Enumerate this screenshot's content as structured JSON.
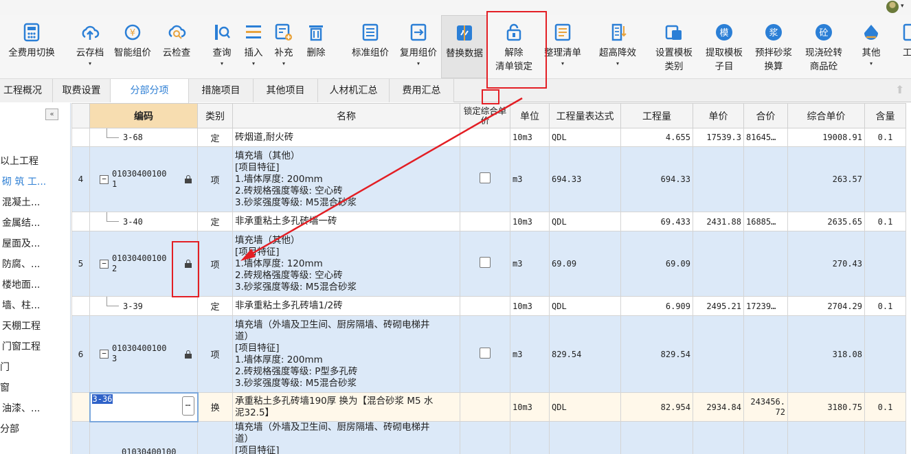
{
  "toolbar": {
    "buttons": [
      {
        "label": "全费用切换",
        "icon": "calculator-icon",
        "color": "#2b7fd6"
      },
      {
        "label": "云存档",
        "icon": "cloud-upload-icon",
        "color": "#2b7fd6"
      },
      {
        "label": "智能组价",
        "icon": "smart-price-icon",
        "color": "#2b7fd6"
      },
      {
        "label": "云检查",
        "icon": "cloud-search-icon",
        "color": "#2b7fd6"
      },
      {
        "label": "查询",
        "icon": "query-icon",
        "color": "#2b7fd6"
      },
      {
        "label": "插入",
        "icon": "insert-icon",
        "color": "#2b7fd6"
      },
      {
        "label": "补充",
        "icon": "supplement-icon",
        "color": "#2b7fd6"
      },
      {
        "label": "删除",
        "icon": "trash-icon",
        "color": "#2b7fd6"
      },
      {
        "label": "标准组价",
        "icon": "standard-price-icon",
        "color": "#2b7fd6"
      },
      {
        "label": "复用组价",
        "icon": "reuse-price-icon",
        "color": "#2b7fd6"
      },
      {
        "label": "替换数据",
        "icon": "replace-data-icon",
        "color": "#2b7fd6"
      },
      {
        "label": "解除",
        "label2": "清单锁定",
        "icon": "unlock-icon",
        "color": "#2b7fd6"
      },
      {
        "label": "整理清单",
        "icon": "organize-list-icon",
        "color": "#2b7fd6"
      },
      {
        "label": "超高降效",
        "icon": "high-rise-icon",
        "color": "#2b7fd6"
      },
      {
        "label": "设置模板",
        "label2": "类别",
        "icon": "template-category-icon",
        "color": "#2b7fd6"
      },
      {
        "label": "提取模板",
        "label2": "子目",
        "icon": "extract-template-icon",
        "glyph": "模",
        "color": "#2b7fd6"
      },
      {
        "label": "预拌砂浆",
        "label2": "换算",
        "icon": "mortar-icon",
        "glyph": "浆",
        "color": "#2b7fd6"
      },
      {
        "label": "现浇砼转",
        "label2": "商品砼",
        "icon": "concrete-icon",
        "glyph": "砼",
        "color": "#2b7fd6"
      },
      {
        "label": "其他",
        "icon": "other-icon",
        "color": "#2b7fd6"
      },
      {
        "label": "工",
        "icon": "tools-icon",
        "color": "#2b7fd6"
      }
    ]
  },
  "tabs": [
    "工程概况",
    "取费设置",
    "分部分项",
    "措施项目",
    "其他项目",
    "人材机汇总",
    "费用汇总"
  ],
  "active_tab": "分部分项",
  "sidebar": {
    "collapse_label": "«",
    "items": [
      "以上工程",
      "砌 筑 工...",
      "混凝土...",
      "金属结...",
      "屋面及...",
      "防腐、...",
      "楼地面...",
      "墙、柱...",
      "天棚工程",
      "门窗工程",
      "门",
      "窗",
      "油漆、...",
      "分部"
    ]
  },
  "grid": {
    "headers": [
      "",
      "编码",
      "类别",
      "名称",
      "锁定综合单价",
      "单位",
      "工程量表达式",
      "工程量",
      "单价",
      "合价",
      "综合单价",
      "含量"
    ],
    "rows": [
      {
        "num": "",
        "code": "3-68",
        "type": "定",
        "name": [
          "砖烟道,耐火砖"
        ],
        "unit": "10m3",
        "expr": "QDL",
        "qty": "4.655",
        "price": "17539.3",
        "total": "81645…",
        "comp": "19008.91",
        "content": "0.1"
      },
      {
        "num": "4",
        "code": "01030400100",
        "code2": "1",
        "type": "项",
        "name": [
          "填充墙（其他）",
          "[项目特征]",
          "1.墙体厚度: 200mm",
          "2.砖规格强度等级: 空心砖",
          "3.砂浆强度等级: M5混合砂浆"
        ],
        "unit": "m3",
        "expr": "694.33",
        "qty": "694.33",
        "price": "",
        "total": "",
        "comp": "263.57",
        "content": ""
      },
      {
        "num": "",
        "code": "3-40",
        "type": "定",
        "name": [
          "非承重粘土多孔砖墙一砖"
        ],
        "unit": "10m3",
        "expr": "QDL",
        "qty": "69.433",
        "price": "2431.88",
        "total": "16885…",
        "comp": "2635.65",
        "content": "0.1"
      },
      {
        "num": "5",
        "code": "01030400100",
        "code2": "2",
        "type": "项",
        "name": [
          "填充墙（其他）",
          "[项目特征]",
          "1.墙体厚度: 120mm",
          "2.砖规格强度等级: 空心砖",
          "3.砂浆强度等级: M5混合砂浆"
        ],
        "unit": "m3",
        "expr": "69.09",
        "qty": "69.09",
        "price": "",
        "total": "",
        "comp": "270.43",
        "content": ""
      },
      {
        "num": "",
        "code": "3-39",
        "type": "定",
        "name": [
          "非承重粘土多孔砖墙1/2砖"
        ],
        "unit": "10m3",
        "expr": "QDL",
        "qty": "6.909",
        "price": "2495.21",
        "total": "17239…",
        "comp": "2704.29",
        "content": "0.1"
      },
      {
        "num": "6",
        "code": "01030400100",
        "code2": "3",
        "type": "项",
        "name": [
          "填充墙（外墙及卫生间、厨房隔墙、砖砌电梯井",
          "道）",
          "[项目特征]",
          "1.墙体厚度: 200mm",
          "2.砖规格强度等级: P型多孔砖",
          "3.砂浆强度等级: M5混合砂浆"
        ],
        "unit": "m3",
        "expr": "829.54",
        "qty": "829.54",
        "price": "",
        "total": "",
        "comp": "318.08",
        "content": ""
      },
      {
        "num": "",
        "code": "3-36",
        "type": "换",
        "name": [
          "承重粘土多孔砖墙190厚  换为【混合砂浆 M5 水",
          "泥32.5】"
        ],
        "unit": "10m3",
        "expr": "QDL",
        "qty": "82.954",
        "price": "2934.84",
        "total": "243456.",
        "total2": "72",
        "comp": "3180.75",
        "content": "0.1"
      },
      {
        "num": "",
        "code": "01030400100",
        "code2": "",
        "type": "",
        "name": [
          "填充墙（外墙及卫生间、厨房隔墙、砖砌电梯井",
          "道）",
          "[项目特征]"
        ],
        "unit": "",
        "expr": "",
        "qty": "",
        "price": "",
        "total": "",
        "comp": "",
        "content": ""
      }
    ]
  },
  "colors": {
    "accent": "#2e7fd4",
    "annotation": "#e31e24",
    "row_blue": "#dce9f8",
    "header_highlight": "#f7ddb0"
  }
}
